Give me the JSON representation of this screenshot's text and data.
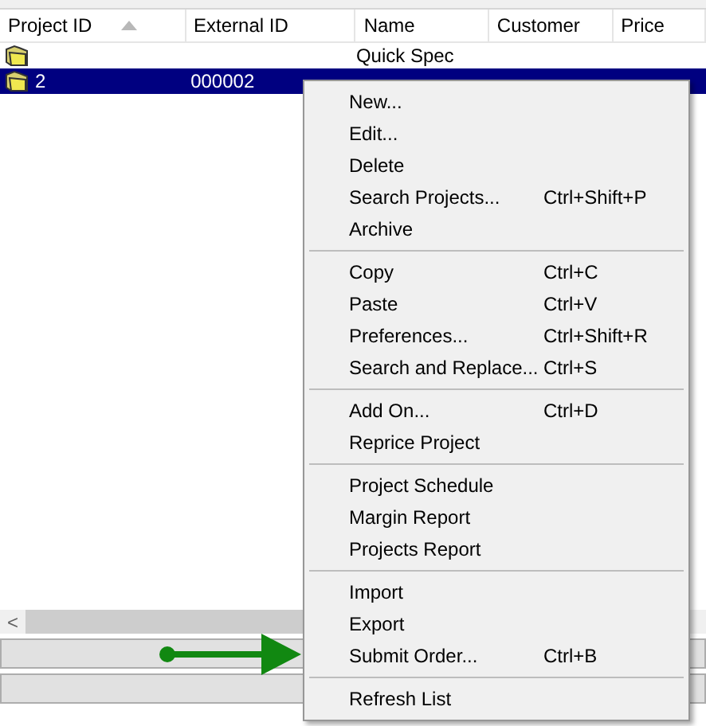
{
  "table": {
    "columns": [
      {
        "label": "Project ID",
        "sorted": true
      },
      {
        "label": "External ID",
        "sorted": false
      },
      {
        "label": "Name",
        "sorted": false
      },
      {
        "label": "Customer",
        "sorted": false
      },
      {
        "label": "Price",
        "sorted": false
      }
    ],
    "rows": [
      {
        "cells": [
          "",
          "",
          "Quick Spec",
          "",
          ""
        ],
        "selected": false
      },
      {
        "cells": [
          "2",
          "000002",
          "",
          "",
          ""
        ],
        "selected": true
      }
    ]
  },
  "context_menu": {
    "groups": [
      [
        {
          "label": "New..."
        },
        {
          "label": "Edit..."
        },
        {
          "label": "Delete"
        },
        {
          "label": "Search Projects...",
          "shortcut": "Ctrl+Shift+P"
        },
        {
          "label": "Archive"
        }
      ],
      [
        {
          "label": "Copy",
          "shortcut": "Ctrl+C"
        },
        {
          "label": "Paste",
          "shortcut": "Ctrl+V"
        },
        {
          "label": "Preferences...",
          "shortcut": "Ctrl+Shift+R"
        },
        {
          "label": "Search and Replace...",
          "shortcut": "Ctrl+S"
        }
      ],
      [
        {
          "label": "Add On...",
          "shortcut": "Ctrl+D"
        },
        {
          "label": "Reprice Project"
        }
      ],
      [
        {
          "label": "Project Schedule"
        },
        {
          "label": "Margin Report"
        },
        {
          "label": "Projects Report"
        }
      ],
      [
        {
          "label": "Import"
        },
        {
          "label": "Export"
        },
        {
          "label": "Submit Order...",
          "shortcut": "Ctrl+B"
        }
      ],
      [
        {
          "label": "Refresh List"
        }
      ]
    ]
  },
  "scrollbar": {
    "left_arrow": "<"
  }
}
